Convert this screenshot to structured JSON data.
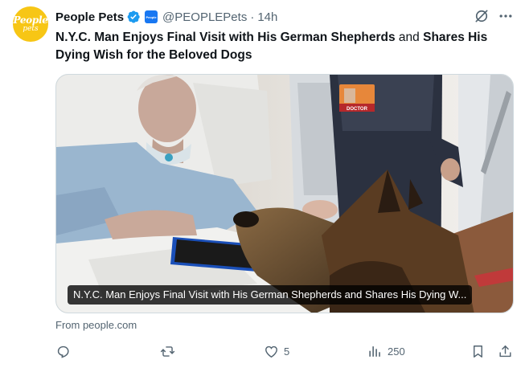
{
  "tweet": {
    "account_name": "People Pets",
    "handle": "@PEOPLEPets",
    "separator": "·",
    "time": "14h",
    "avatar_text_1": "People",
    "avatar_text_2": "pets",
    "affiliate_badge_text": "People",
    "headline_parts": [
      {
        "text": "N.Y.C. Man Enjoys Final Visit with His German Shepherds",
        "bold": true
      },
      {
        "text": " and ",
        "bold": false
      },
      {
        "text": "Shares His Dying Wish for the Beloved Dogs",
        "bold": true
      }
    ],
    "card_caption": "N.Y.C. Man Enjoys Final Visit with His German Shepherds and Shares His Dying W...",
    "badge_text": "DOCTOR",
    "source": "From people.com"
  },
  "actions": {
    "reply": {
      "icon": "reply-icon",
      "count": ""
    },
    "repost": {
      "icon": "repost-icon",
      "count": ""
    },
    "like": {
      "icon": "heart-icon",
      "count": "5"
    },
    "views": {
      "icon": "views-icon",
      "count": "250"
    },
    "bookmark": {
      "icon": "bookmark-icon"
    },
    "share": {
      "icon": "share-icon"
    }
  },
  "colors": {
    "brand_yellow": "#f7c615",
    "verified_blue": "#1d9bf0",
    "text_primary": "#0f1419",
    "text_secondary": "#536471"
  }
}
